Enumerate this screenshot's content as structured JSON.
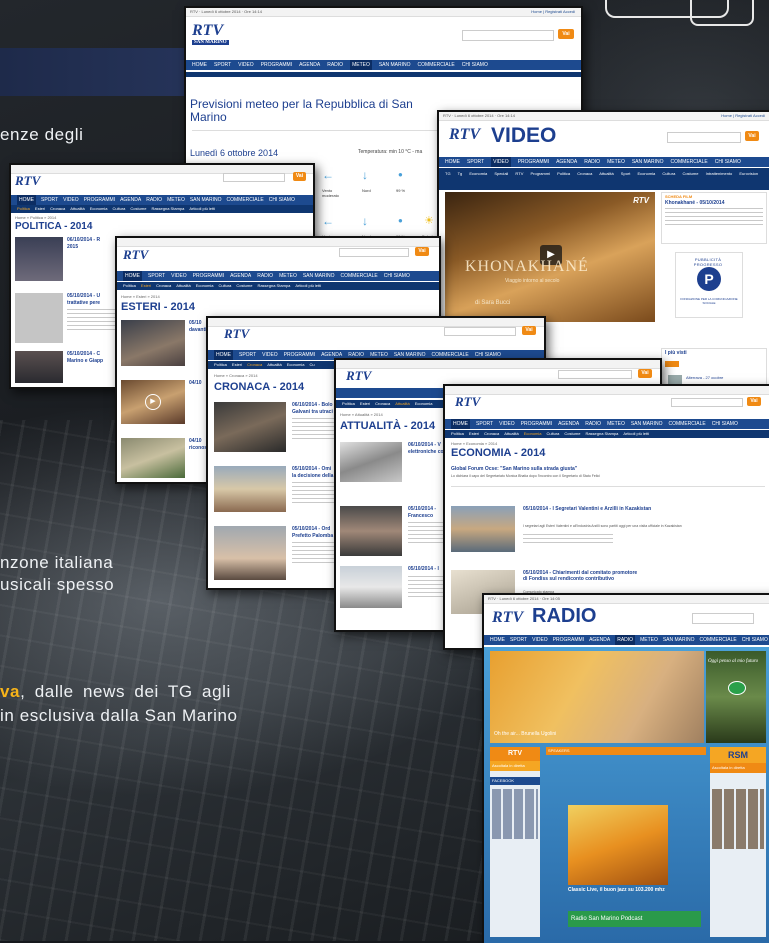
{
  "text_blocks": [
    "enze degli",
    "nzone italiana",
    "usicali spesso"
  ],
  "text_line_emph": {
    "em": "va",
    "rest": ", dalle news dei TG agli"
  },
  "text_line_last": "in esclusiva dalla San Marino",
  "meteo": {
    "topbar": "RTV · Lunedì 6 ottobre 2014 · Ore 14:14",
    "toplinks": "Home | Registrati Accedi",
    "logo": "RTV",
    "logo_sub": "SAN MARINO",
    "nav": [
      "HOME",
      "SPORT",
      "VIDEO",
      "PROGRAMMI",
      "AGENDA",
      "RADIO",
      "METEO",
      "SAN MARINO",
      "COMMERCIALE",
      "CHI SIAMO"
    ],
    "nav_active": "METEO",
    "search_btn": "Vai",
    "title": "Previsioni meteo per la Repubblica di San Marino",
    "date": "Lunedì 6 ottobre 2014",
    "temp": "Temperatura: min 10 °C - ma",
    "wind_label": "Vento moderato",
    "dir": "Nord",
    "hum": "99 %",
    "wind2": "Vento",
    "dir2": "Nord",
    "hum2": "99 %",
    "sky2": "Debole"
  },
  "video": {
    "topbar": "RTV · Lunedì 6 ottobre 2014 · Ore 14:14",
    "toplinks": "Home | Registrati Accedi",
    "logo": "RTV",
    "brand": "VIDEO",
    "nav": [
      "HOME",
      "SPORT",
      "VIDEO",
      "PROGRAMMI",
      "AGENDA",
      "RADIO",
      "METEO",
      "SAN MARINO",
      "COMMERCIALE",
      "CHI SIAMO"
    ],
    "nav_active": "VIDEO",
    "sub": [
      "TG",
      "Tg Economia",
      "Speciali RTV",
      "Programmi",
      "Politica",
      "Cronaca",
      "Attualità",
      "Sport",
      "Economia",
      "Cultura",
      "Costume",
      "Intrattenimento",
      "Eurovision"
    ],
    "player_title": "KHONAKHANÉ",
    "player_sub": "Viaggio intorno al secolo",
    "player_credit": "di Sara Bucci",
    "side_tag": "SCHEDA FILM",
    "side_head": "Khonakhané - 05/10/2014",
    "ad_letter": "P",
    "ad_top": "PUBBLICITÀ PROGRESSO",
    "ad_bottom": "FONDAZIONE PER LA COMUNICAZIONE SOCIALE",
    "popular": "I più visti",
    "popular_item": "Alterrava - 27 ocobre"
  },
  "politica": {
    "logo": "RTV",
    "nav": [
      "HOME",
      "SPORT",
      "VIDEO",
      "PROGRAMMI",
      "AGENDA",
      "RADIO",
      "METEO",
      "SAN MARINO",
      "COMMERCIALE",
      "CHI SIAMO"
    ],
    "sub": [
      "Politica",
      "Esteri",
      "Cronaca",
      "Attualità",
      "Economia",
      "Cultura",
      "Costume",
      "Rassegna Stampa",
      "Articoli più letti"
    ],
    "sub_active": "Politica",
    "crumb": "Home » Politica » 2014",
    "title": "POLITICA - 2014",
    "items": [
      {
        "head": "06/10/2014 - R",
        "sub": "2015"
      },
      {
        "head": "05/10/2014 - U",
        "sub": "trattative pere"
      },
      {
        "head": "05/10/2014 - C",
        "sub": "Marino e Giapp"
      }
    ]
  },
  "esteri": {
    "logo": "RTV",
    "nav": [
      "HOME",
      "SPORT",
      "VIDEO",
      "PROGRAMMI",
      "AGENDA",
      "RADIO",
      "METEO",
      "SAN MARINO",
      "COMMERCIALE",
      "CHI SIAMO"
    ],
    "sub": [
      "Politica",
      "Esteri",
      "Cronaca",
      "Attualità",
      "Economia",
      "Cultura",
      "Costume",
      "Rassegna Stampa",
      "Articoli più letti"
    ],
    "sub_active": "Esteri",
    "crumb": "Home » Esteri » 2014",
    "title": "ESTERI - 2014",
    "items": [
      {
        "head": "05/10",
        "sub": "davanti"
      },
      {
        "head": "04/10",
        "sub": ""
      },
      {
        "head": "04/10",
        "sub": "riconosc"
      }
    ]
  },
  "cronaca": {
    "logo": "RTV",
    "nav": [
      "HOME",
      "SPORT",
      "VIDEO",
      "PROGRAMMI",
      "AGENDA",
      "RADIO",
      "METEO",
      "SAN MARINO",
      "COMMERCIALE",
      "CHI SIAMO"
    ],
    "sub": [
      "Politica",
      "Esteri",
      "Cronaca",
      "Attualità",
      "Economia",
      "Cu"
    ],
    "sub_active": "Cronaca",
    "crumb": "Home » Cronaca » 2014",
    "title": "CRONACA - 2014",
    "items": [
      {
        "head": "06/10/2014 - Bolo",
        "sub": "Galvani tra utraci"
      },
      {
        "head": "05/10/2014 - Omi",
        "sub": "la decisione della"
      },
      {
        "head": "05/10/2014 - Ord",
        "sub": "Prefetto Palomba"
      }
    ]
  },
  "attualita": {
    "logo": "RTV",
    "sub": [
      "Politica",
      "Esteri",
      "Cronaca",
      "Attualità",
      "Economia"
    ],
    "sub_active": "Attualità",
    "crumb": "Home » Attualità » 2014",
    "title": "ATTUALITÀ - 2014",
    "items": [
      {
        "head": "06/10/2014 - V",
        "sub": "elettroniche co"
      },
      {
        "head": "05/10/2014 - ",
        "sub": "Francesco"
      },
      {
        "head": "05/10/2014 - I",
        "sub": ""
      }
    ]
  },
  "economia": {
    "logo": "RTV",
    "nav": [
      "HOME",
      "SPORT",
      "VIDEO",
      "PROGRAMMI",
      "AGENDA",
      "RADIO",
      "METEO",
      "SAN MARINO",
      "COMMERCIALE",
      "CHI SIAMO"
    ],
    "sub": [
      "Politica",
      "Esteri",
      "Cronaca",
      "Attualità",
      "Economia",
      "Cultura",
      "Costume",
      "Rassegna Stampa",
      "Articoli più letti"
    ],
    "sub_active": "Economia",
    "crumb": "Home » Economia » 2014",
    "title": "ECONOMIA - 2014",
    "lead_head": "Global Forum Ocse: \"San Marino sulla strada giusta\"",
    "lead_sub": "Lo dichiara il capo del Segretariato Monica Bhatia dopo l'incontro con il Segretario di Stato Felici",
    "items": [
      {
        "head": "05/10/2014 - I Segretari Valentini e Arzilli in Kazakistan",
        "sub": "I segretari agli Esteri Valentini e all'Industria Arzilli sono partiti oggi per una visita ufficiale in Kazakistan"
      },
      {
        "head": "05/10/2014 - Chiarimenti dal comitato promotore di Fondiss sul rendiconto contributivo",
        "sub": "Comunicato stampa"
      }
    ]
  },
  "radio": {
    "topbar": "RTV · Lunedì 6 ottobre 2014 · Ore 14:05",
    "logo": "RTV",
    "brand": "RADIO",
    "nav": [
      "HOME",
      "SPORT",
      "VIDEO",
      "PROGRAMMI",
      "AGENDA",
      "RADIO",
      "METEO",
      "SAN MARINO",
      "COMMERCIALE",
      "CHI SIAMO"
    ],
    "nav_active": "RADIO",
    "hero_caption": "Oh the air... Brunella Ugolini",
    "hero_right": "Oggi penso al mio futuro",
    "speakers": "SPEAKERS",
    "listen": "Ascoltala in diretta",
    "facebook": "FACEBOOK",
    "classic_title": "Classic Live, il buon jazz su 103.200 mhz",
    "podcast": "Radio San Marino Podcast",
    "rsm": "RSM",
    "rsm_listen": "Ascoltala in diretta"
  }
}
